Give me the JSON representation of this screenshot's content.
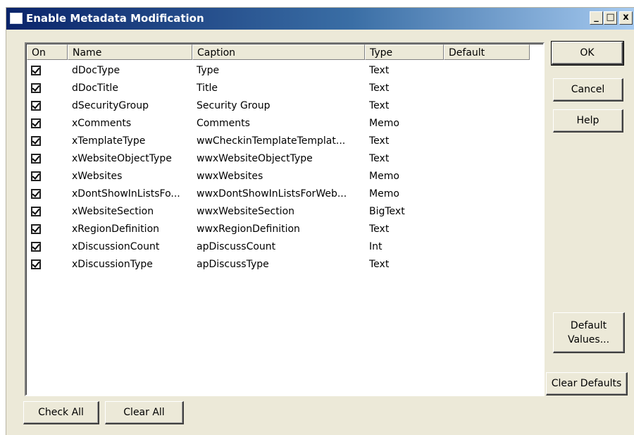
{
  "window": {
    "title": "Enable Metadata Modification",
    "min_glyph": "_",
    "max_glyph": "□",
    "close_glyph": "x"
  },
  "columns": [
    "On",
    "Name",
    "Caption",
    "Type",
    "Default"
  ],
  "rows": [
    {
      "on": true,
      "name": "dDocType",
      "caption": "Type",
      "type": "Text",
      "default": ""
    },
    {
      "on": true,
      "name": "dDocTitle",
      "caption": "Title",
      "type": "Text",
      "default": ""
    },
    {
      "on": true,
      "name": "dSecurityGroup",
      "caption": "Security Group",
      "type": "Text",
      "default": ""
    },
    {
      "on": true,
      "name": "xComments",
      "caption": "Comments",
      "type": "Memo",
      "default": ""
    },
    {
      "on": true,
      "name": "xTemplateType",
      "caption": "wwCheckinTemplateTemplat...",
      "type": "Text",
      "default": ""
    },
    {
      "on": true,
      "name": "xWebsiteObjectType",
      "caption": "wwxWebsiteObjectType",
      "type": "Text",
      "default": ""
    },
    {
      "on": true,
      "name": "xWebsites",
      "caption": "wwxWebsites",
      "type": "Memo",
      "default": ""
    },
    {
      "on": true,
      "name": "xDontShowInListsFo...",
      "caption": "wwxDontShowInListsForWeb...",
      "type": "Memo",
      "default": ""
    },
    {
      "on": true,
      "name": "xWebsiteSection",
      "caption": "wwxWebsiteSection",
      "type": "BigText",
      "default": ""
    },
    {
      "on": true,
      "name": "xRegionDefinition",
      "caption": "wwxRegionDefinition",
      "type": "Text",
      "default": ""
    },
    {
      "on": true,
      "name": "xDiscussionCount",
      "caption": "apDiscussCount",
      "type": "Int",
      "default": ""
    },
    {
      "on": true,
      "name": "xDiscussionType",
      "caption": "apDiscussType",
      "type": "Text",
      "default": ""
    }
  ],
  "buttons": {
    "ok": "OK",
    "cancel": "Cancel",
    "help": "Help",
    "default_values": "Default\nValues...",
    "clear_defaults": "Clear Defaults",
    "check_all": "Check All",
    "clear_all": "Clear All"
  },
  "colors": {
    "titlebar_start": "#0a246a",
    "titlebar_end": "#a6caf0",
    "dialog_bg": "#ece9d8"
  }
}
